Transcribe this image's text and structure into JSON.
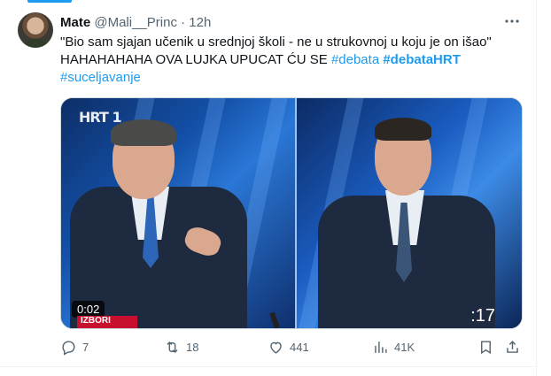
{
  "tweet": {
    "author_name": "Mate",
    "handle": "@Mali__Princ",
    "separator": "·",
    "time": "12h",
    "text_line1": "\"Bio sam sjajan učenik u srednjoj školi -  ne u strukovnoj u koju je on išao\"",
    "text_line2": "HAHAHAHAHA OVA LUJKA UPUCAT ĆU SE",
    "hashtag1": "#debata",
    "hashtag2": "#debataHRT",
    "hashtag3": "#suceljavanje"
  },
  "media": {
    "channel_logo": "HRT 1",
    "timecode": "0:02",
    "badge_text": "IZBORI",
    "counter": ":17"
  },
  "actions": {
    "reply_count": "7",
    "retweet_count": "18",
    "like_count": "441",
    "views_count": "41K"
  },
  "icons": [
    "reply-icon",
    "retweet-icon",
    "like-icon",
    "views-icon",
    "bookmark-icon",
    "share-icon",
    "more-icon"
  ],
  "colors": {
    "accent": "#1d9bf0",
    "text": "#0f1419",
    "muted": "#536471"
  }
}
